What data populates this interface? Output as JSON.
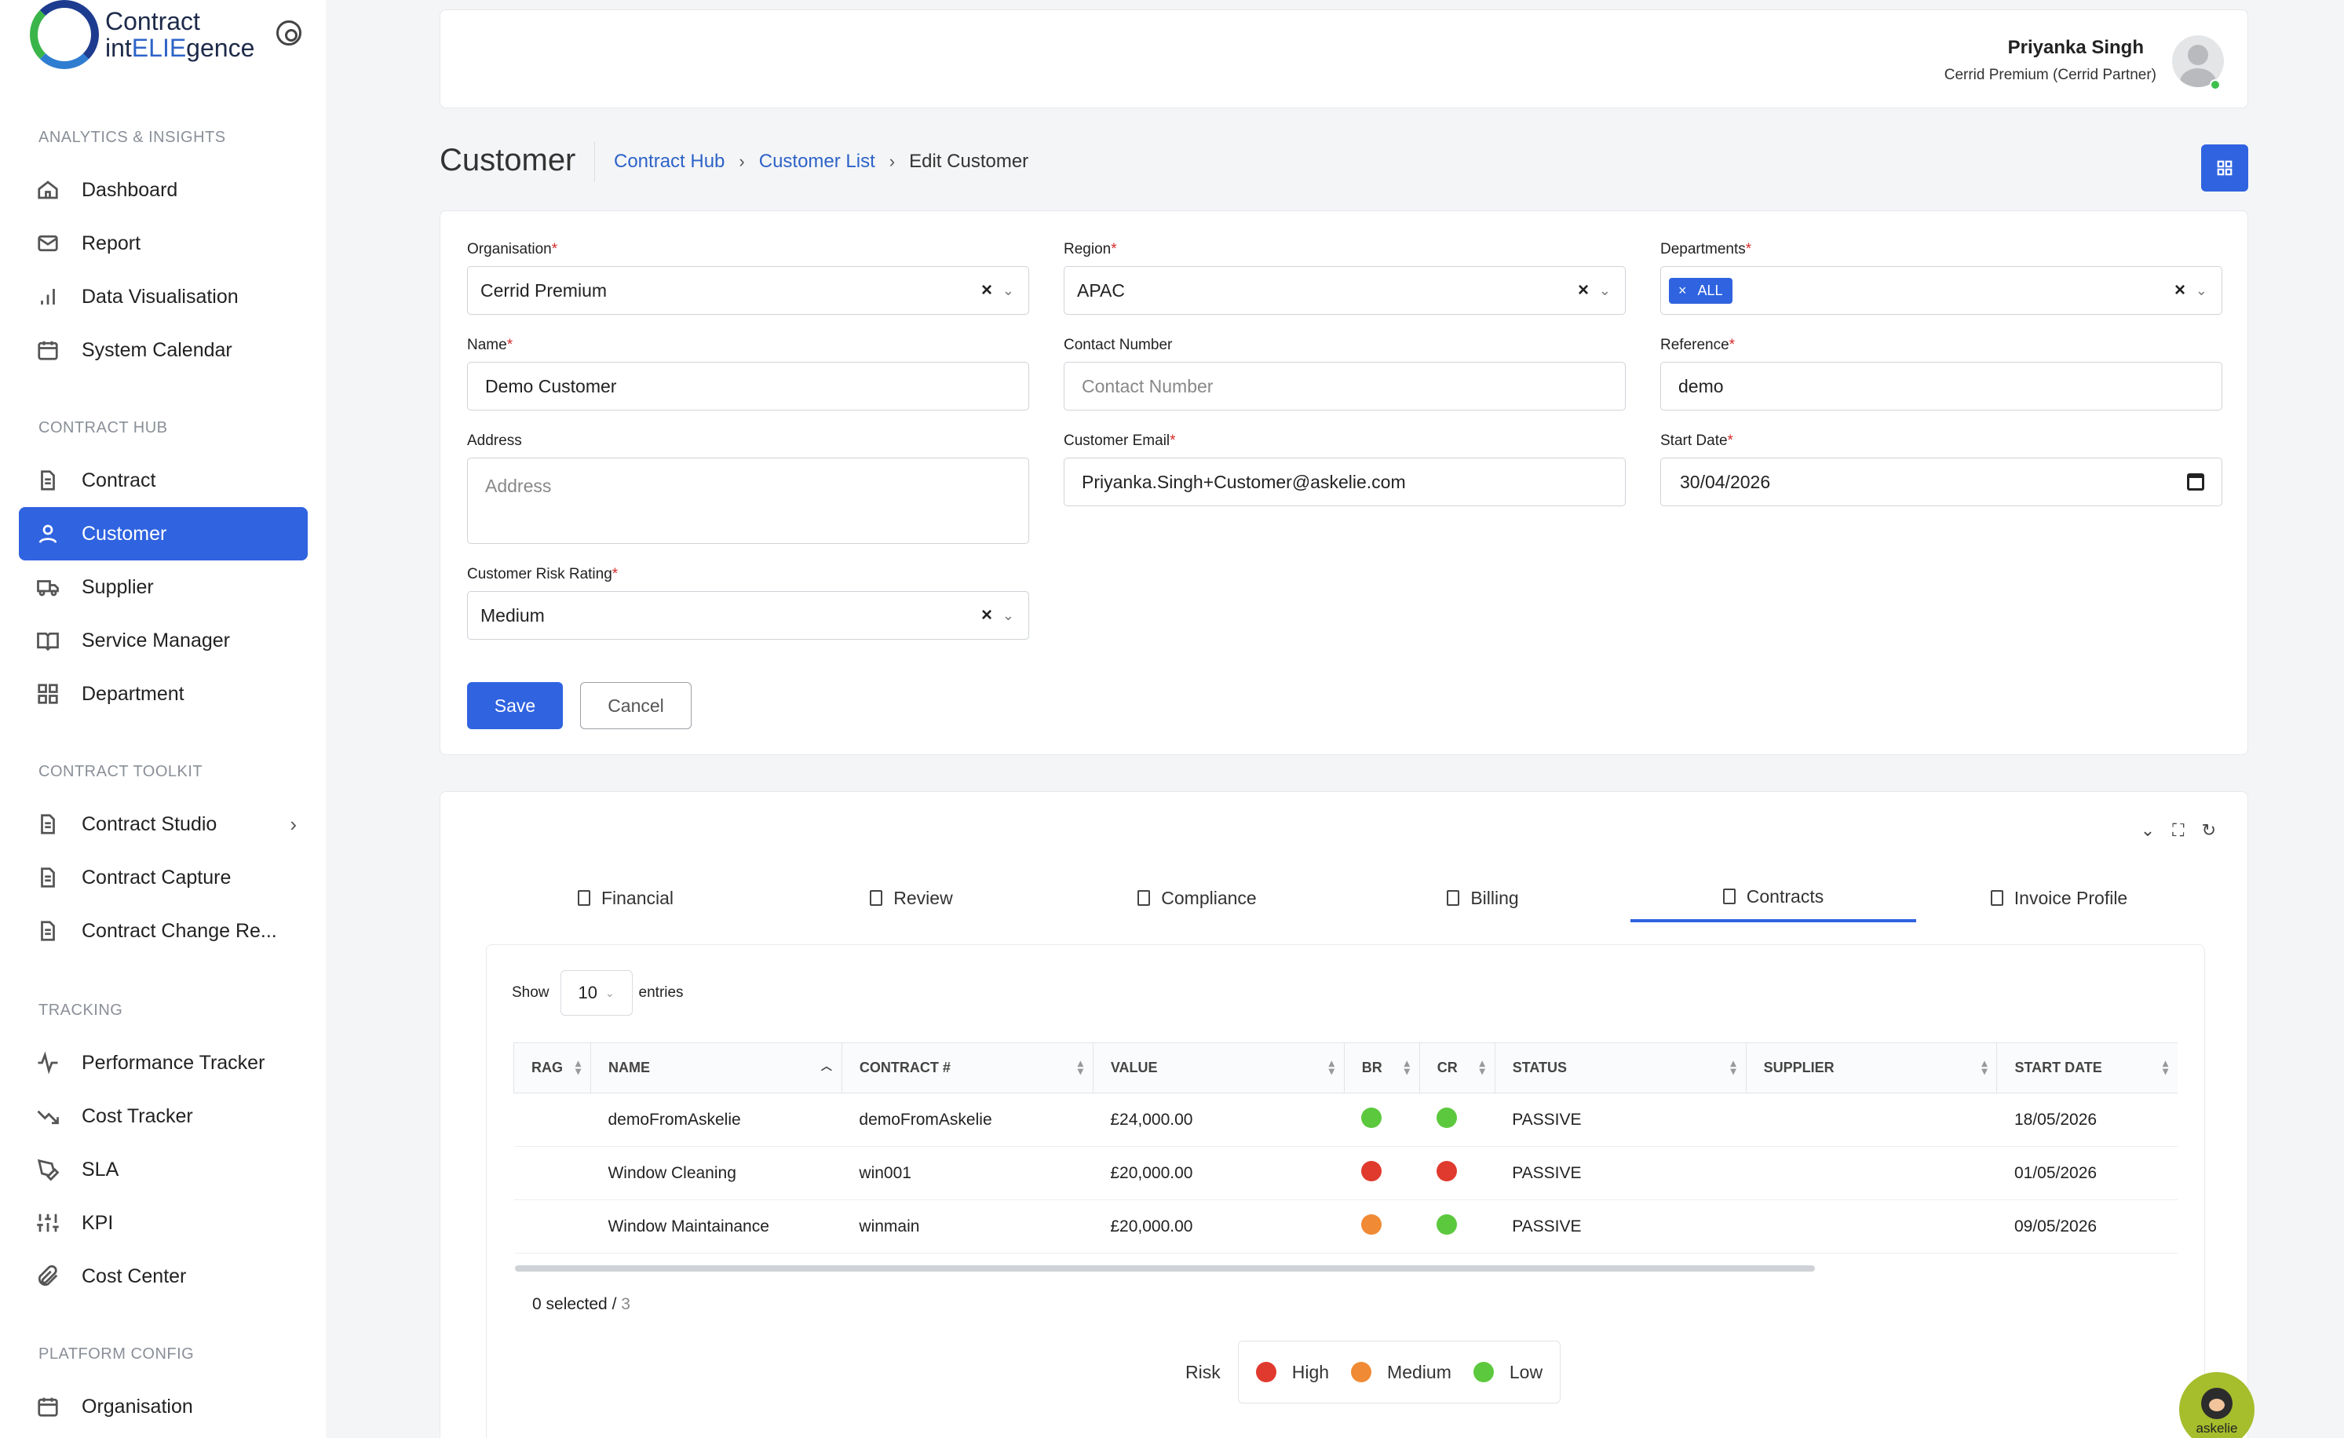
{
  "app": {
    "logo_line1": "Contract",
    "logo_line2_a": "int",
    "logo_line2_b": "ELIE",
    "logo_line2_c": "gence"
  },
  "sidebar": {
    "sections": [
      {
        "title": "ANALYTICS & INSIGHTS"
      },
      {
        "title": "CONTRACT HUB"
      },
      {
        "title": "CONTRACT TOOLKIT"
      },
      {
        "title": "TRACKING"
      },
      {
        "title": "PLATFORM CONFIG"
      }
    ],
    "items": [
      {
        "label": "Dashboard",
        "icon": "home-icon"
      },
      {
        "label": "Report",
        "icon": "mail-icon"
      },
      {
        "label": "Data Visualisation",
        "icon": "bar-chart-icon"
      },
      {
        "label": "System Calendar",
        "icon": "calendar-icon"
      },
      {
        "label": "Contract",
        "icon": "document-icon"
      },
      {
        "label": "Customer",
        "icon": "user-icon",
        "active": true
      },
      {
        "label": "Supplier",
        "icon": "truck-icon"
      },
      {
        "label": "Service Manager",
        "icon": "book-icon"
      },
      {
        "label": "Department",
        "icon": "grid-icon"
      },
      {
        "label": "Contract Studio",
        "icon": "document-icon"
      },
      {
        "label": "Contract Capture",
        "icon": "document-icon"
      },
      {
        "label": "Contract Change Re...",
        "icon": "document-icon"
      },
      {
        "label": "Performance Tracker",
        "icon": "activity-icon"
      },
      {
        "label": "Cost Tracker",
        "icon": "trending-down-icon"
      },
      {
        "label": "SLA",
        "icon": "pen-tool-icon"
      },
      {
        "label": "KPI",
        "icon": "sliders-icon"
      },
      {
        "label": "Cost Center",
        "icon": "paperclip-icon"
      },
      {
        "label": "Organisation",
        "icon": "calendar-icon"
      }
    ]
  },
  "header": {
    "user_name": "Priyanka Singh",
    "user_role": "Cerrid Premium (Cerrid Partner)"
  },
  "page": {
    "title": "Customer",
    "breadcrumb": [
      "Contract Hub",
      "Customer List",
      "Edit Customer"
    ]
  },
  "form": {
    "organisation": {
      "label": "Organisation",
      "value": "Cerrid Premium"
    },
    "region": {
      "label": "Region",
      "value": "APAC"
    },
    "departments": {
      "label": "Departments",
      "tag": "ALL"
    },
    "name": {
      "label": "Name",
      "value": "Demo Customer"
    },
    "contact_number": {
      "label": "Contact Number",
      "placeholder": "Contact Number"
    },
    "reference": {
      "label": "Reference",
      "value": "demo"
    },
    "address": {
      "label": "Address",
      "placeholder": "Address"
    },
    "customer_email": {
      "label": "Customer Email",
      "value": "Priyanka.Singh+Customer@askelie.com"
    },
    "start_date": {
      "label": "Start Date",
      "value": "30/04/2026"
    },
    "risk_rating": {
      "label": "Customer Risk Rating",
      "value": "Medium"
    },
    "required_mark": "*",
    "save_label": "Save",
    "cancel_label": "Cancel"
  },
  "tabs": [
    {
      "label": "Financial"
    },
    {
      "label": "Review"
    },
    {
      "label": "Compliance"
    },
    {
      "label": "Billing"
    },
    {
      "label": "Contracts",
      "active": true
    },
    {
      "label": "Invoice Profile"
    }
  ],
  "table": {
    "show_label": "Show",
    "entries_value": "10",
    "entries_label": "entries",
    "columns": [
      "RAG",
      "NAME",
      "CONTRACT #",
      "VALUE",
      "BR",
      "CR",
      "STATUS",
      "SUPPLIER",
      "START DATE"
    ],
    "rows": [
      {
        "name": "demoFromAskelie",
        "contract": "demoFromAskelie",
        "value": "£24,000.00",
        "br": "#5cc83e",
        "cr": "#5cc83e",
        "status": "PASSIVE",
        "supplier": "",
        "start": "18/05/2026"
      },
      {
        "name": "Window Cleaning",
        "contract": "win001",
        "value": "£20,000.00",
        "br": "#e03a2e",
        "cr": "#e03a2e",
        "status": "PASSIVE",
        "supplier": "",
        "start": "01/05/2026"
      },
      {
        "name": "Window Maintainance",
        "contract": "winmain",
        "value": "£20,000.00",
        "br": "#f08a34",
        "cr": "#5cc83e",
        "status": "PASSIVE",
        "supplier": "",
        "start": "09/05/2026"
      }
    ],
    "selected_text": "0 selected / ",
    "total": "3"
  },
  "legend": {
    "title": "Risk",
    "items": [
      {
        "label": "High",
        "color": "#e03a2e"
      },
      {
        "label": "Medium",
        "color": "#f08a34"
      },
      {
        "label": "Low",
        "color": "#5cc83e"
      }
    ]
  },
  "assistant": {
    "label": "askelie"
  },
  "colors": {
    "accent": "#2f63e0"
  }
}
